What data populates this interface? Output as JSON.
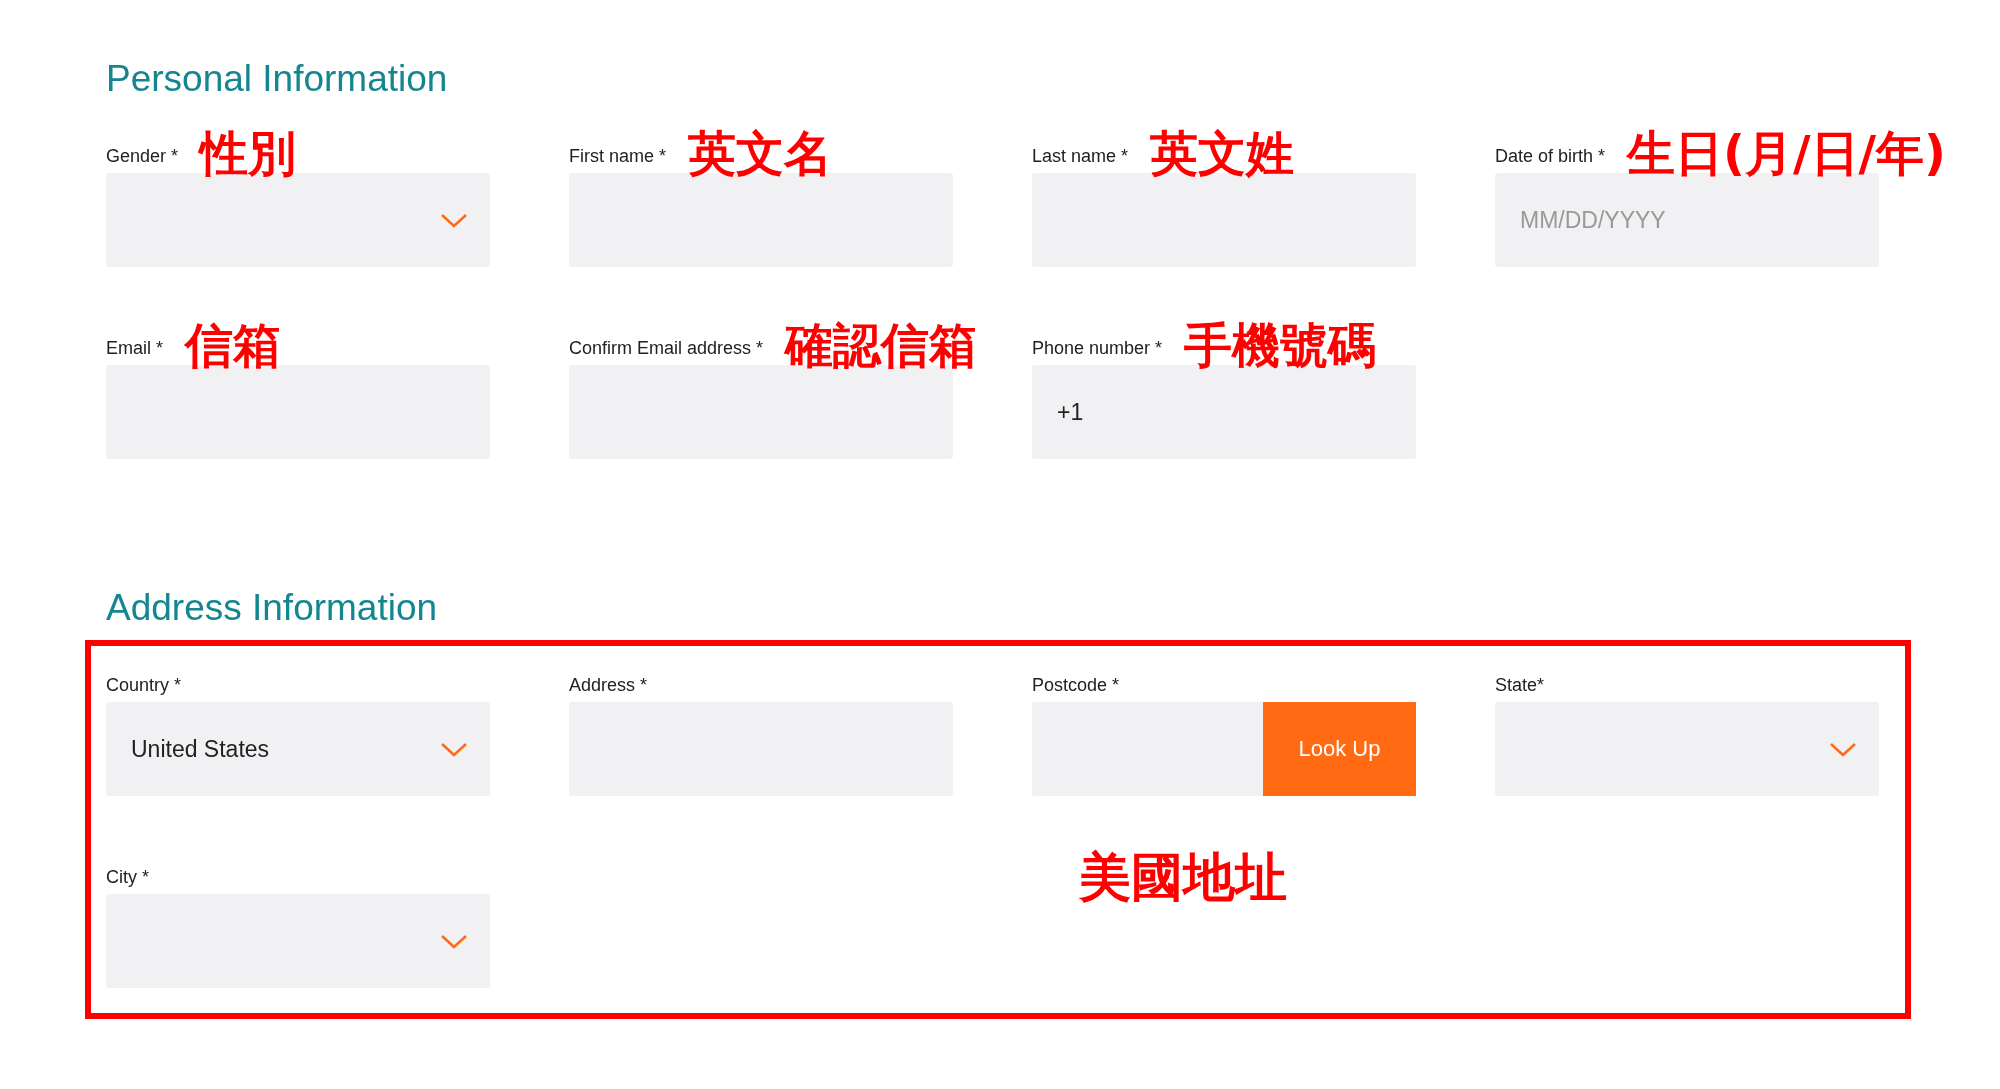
{
  "sections": [
    {
      "title": "Personal Information",
      "highlighted": false,
      "rows": [
        [
          {
            "kind": "select",
            "label": "Gender *",
            "annotation": "性別"
          },
          {
            "kind": "text",
            "label": "First name *",
            "annotation": "英文名"
          },
          {
            "kind": "text",
            "label": "Last name *",
            "annotation": "英文姓"
          },
          {
            "kind": "text",
            "label": "Date of birth *",
            "annotation": "生日(月/日/年)",
            "placeholder": "MM/DD/YYYY"
          }
        ],
        [
          {
            "kind": "text",
            "label": "Email *",
            "annotation": "信箱"
          },
          {
            "kind": "text",
            "label": "Confirm Email address *",
            "annotation": "確認信箱"
          },
          {
            "kind": "text",
            "label": "Phone number *",
            "annotation": "手機號碼",
            "value": "+1"
          }
        ]
      ]
    },
    {
      "title": "Address Information",
      "highlighted": true,
      "annotation": "美國地址",
      "rows": [
        [
          {
            "kind": "select",
            "label": "Country *",
            "value": "United States"
          },
          {
            "kind": "text",
            "label": "Address *"
          },
          {
            "kind": "lookup",
            "label": "Postcode *",
            "button": "Look Up"
          },
          {
            "kind": "select",
            "label": "State*"
          }
        ],
        [
          {
            "kind": "select",
            "label": "City *"
          }
        ]
      ]
    }
  ]
}
